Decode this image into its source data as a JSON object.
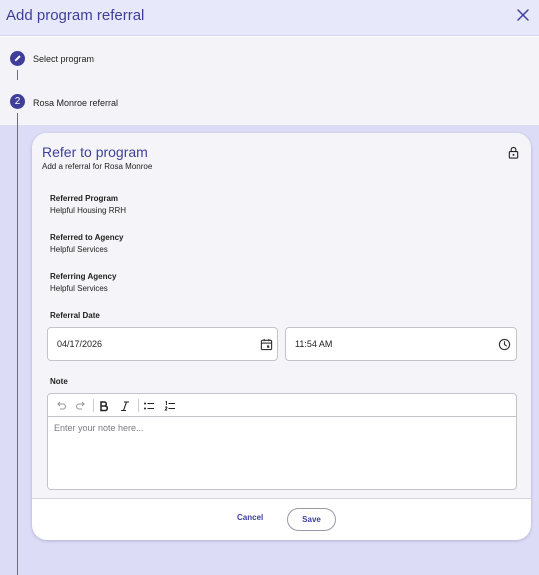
{
  "dialog": {
    "title": "Add program referral"
  },
  "steps": [
    {
      "number": "",
      "label": "Select program",
      "state": "completed"
    },
    {
      "number": "2",
      "label": "Rosa Monroe referral",
      "state": "active"
    }
  ],
  "card": {
    "title": "Refer to program",
    "subtitle": "Add a referral for Rosa Monroe",
    "fields": [
      {
        "label": "Referred Program",
        "value": "Helpful Housing RRH"
      },
      {
        "label": "Referred to Agency",
        "value": "Helpful Services"
      },
      {
        "label": "Referring Agency",
        "value": "Helpful Services"
      }
    ],
    "referral_date": {
      "label": "Referral Date",
      "date_value": "04/17/2026",
      "time_value": "11:54 AM"
    },
    "note": {
      "label": "Note",
      "placeholder": "Enter your note here...",
      "value": ""
    }
  },
  "actions": {
    "cancel_label": "Cancel",
    "save_label": "Save"
  },
  "colors": {
    "accent": "#3f3f99",
    "header_bg": "#e8e8fb",
    "body_bg": "#dcdcf7"
  }
}
